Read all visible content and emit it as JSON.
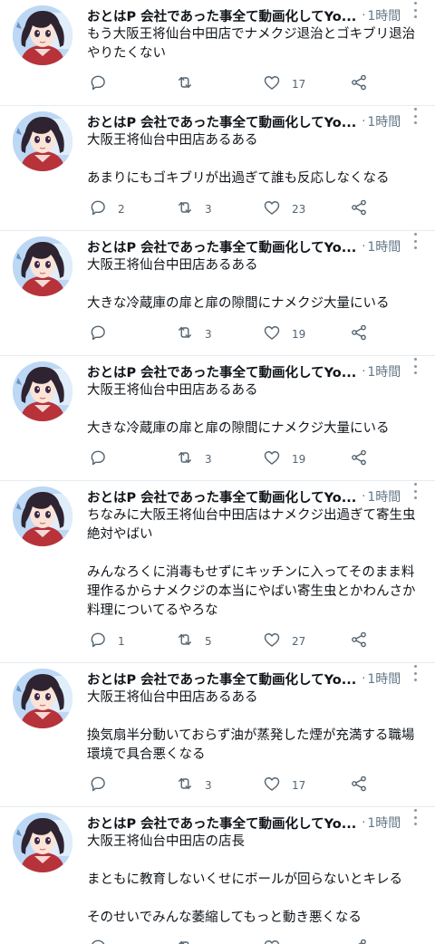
{
  "tweets": [
    {
      "author": "おとはP 会社であった事全て動画化してYo...",
      "separator": "·",
      "time": "1時間",
      "text": "もう大阪王将仙台中田店でナメクジ退治とゴキブリ退治\nやりたくない",
      "replies": "",
      "retweets": "",
      "likes": "17"
    },
    {
      "author": "おとはP 会社であった事全て動画化してYo...",
      "separator": "·",
      "time": "1時間",
      "text": "大阪王将仙台中田店あるある\n\nあまりにもゴキブリが出過ぎて誰も反応しなくなる",
      "replies": "2",
      "retweets": "3",
      "likes": "23"
    },
    {
      "author": "おとはP 会社であった事全て動画化してYo...",
      "separator": "·",
      "time": "1時間",
      "text": "大阪王将仙台中田店あるある\n\n大きな冷蔵庫の扉と扉の隙間にナメクジ大量にいる",
      "replies": "",
      "retweets": "3",
      "likes": "19"
    },
    {
      "author": "おとはP 会社であった事全て動画化してYo...",
      "separator": "·",
      "time": "1時間",
      "text": "大阪王将仙台中田店あるある\n\n大きな冷蔵庫の扉と扉の隙間にナメクジ大量にいる",
      "replies": "",
      "retweets": "3",
      "likes": "19"
    },
    {
      "author": "おとはP 会社であった事全て動画化してYo...",
      "separator": "·",
      "time": "1時間",
      "text": "ちなみに大阪王将仙台中田店はナメクジ出過ぎて寄生虫\n絶対やばい\n\nみんなろくに消毒もせずにキッチンに入ってそのまま料\n理作るからナメクジの本当にやばい寄生虫とかわんさか\n料理についてるやろな",
      "replies": "1",
      "retweets": "5",
      "likes": "27"
    },
    {
      "author": "おとはP 会社であった事全て動画化してYo...",
      "separator": "·",
      "time": "1時間",
      "text": "大阪王将仙台中田店あるある\n\n換気扇半分動いておらず油が蒸発した煙が充満する職場\n環境で具合悪くなる",
      "replies": "",
      "retweets": "3",
      "likes": "17"
    },
    {
      "author": "おとはP 会社であった事全て動画化してYo...",
      "separator": "·",
      "time": "1時間",
      "text": "大阪王将仙台中田店の店長\n\nまともに教育しないくせにボールが回らないとキレる\n\nそのせいでみんな萎縮してもっと動き悪くなる",
      "replies": "",
      "retweets": "",
      "likes": ""
    }
  ],
  "icons": {
    "reply": "speech-bubble",
    "retweet": "two-arrows-loop",
    "like": "heart-outline",
    "share": "share-nodes",
    "more": "vertical-ellipsis"
  },
  "colors": {
    "text": "#0f1419",
    "meta": "#657786",
    "icon": "#536471",
    "divider": "#e6ecf0"
  }
}
